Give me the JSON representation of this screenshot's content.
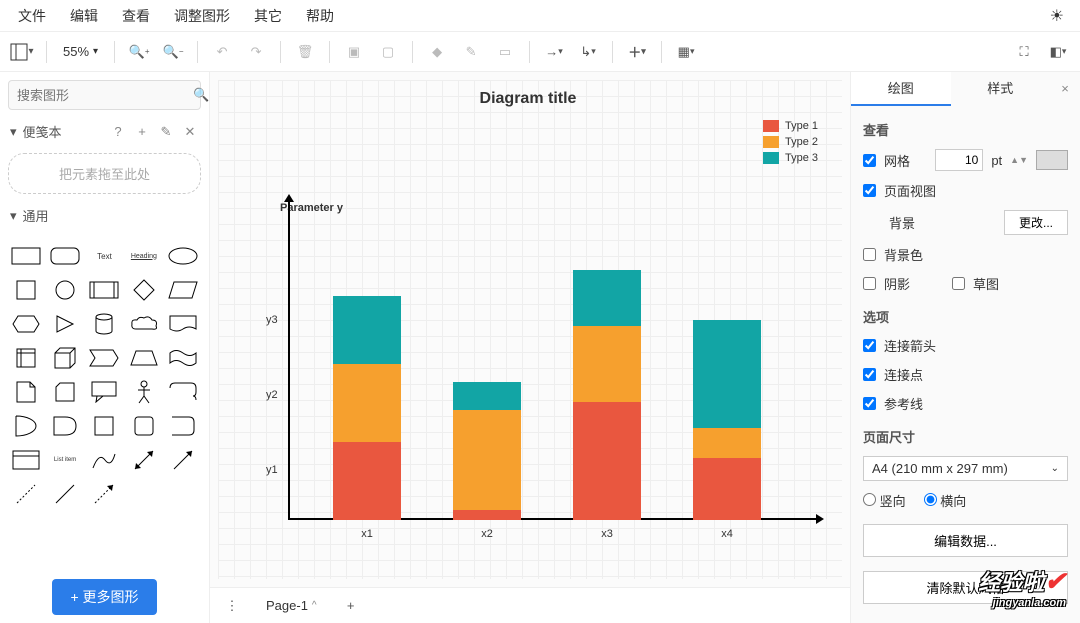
{
  "menu": {
    "items": [
      "文件",
      "编辑",
      "查看",
      "调整图形",
      "其它",
      "帮助"
    ]
  },
  "toolbar": {
    "zoom": "55%"
  },
  "left": {
    "search_placeholder": "搜索图形",
    "scratchpad_label": "便笺本",
    "drop_hint": "把元素拖至此处",
    "general_label": "通用",
    "more_shapes": "+ 更多图形",
    "shape_text_label": "Text",
    "shape_heading_label": "Heading",
    "shape_listitem_label": "List item"
  },
  "pages": {
    "tab1": "Page-1"
  },
  "right": {
    "tab_draw": "绘图",
    "tab_style": "样式",
    "section_view": "查看",
    "grid": "网格",
    "grid_size": "10",
    "grid_unit": "pt",
    "page_view": "页面视图",
    "background": "背景",
    "change": "更改...",
    "bg_color": "背景色",
    "shadow": "阴影",
    "sketch": "草图",
    "section_options": "选项",
    "conn_arrows": "连接箭头",
    "conn_points": "连接点",
    "guides": "参考线",
    "section_pagesize": "页面尺寸",
    "pagesize_value": "A4 (210 mm x 297 mm)",
    "orient_portrait": "竖向",
    "orient_landscape": "横向",
    "edit_data": "编辑数据...",
    "clear_default": "清除默认风格"
  },
  "chart_data": {
    "type": "bar",
    "title": "Diagram title",
    "ylabel": "Parameter y",
    "categories": [
      "x1",
      "x2",
      "x3",
      "x4"
    ],
    "yticks": [
      "y1",
      "y2",
      "y3"
    ],
    "series": [
      {
        "name": "Type 1",
        "color": "#e9573f",
        "values": [
          78,
          10,
          118,
          62
        ]
      },
      {
        "name": "Type 2",
        "color": "#f6a02e",
        "values": [
          78,
          100,
          76,
          30
        ]
      },
      {
        "name": "Type 3",
        "color": "#12a5a5",
        "values": [
          68,
          28,
          56,
          108
        ]
      }
    ]
  },
  "watermark": {
    "brand": "经验啦",
    "url": "jingyanla.com"
  }
}
